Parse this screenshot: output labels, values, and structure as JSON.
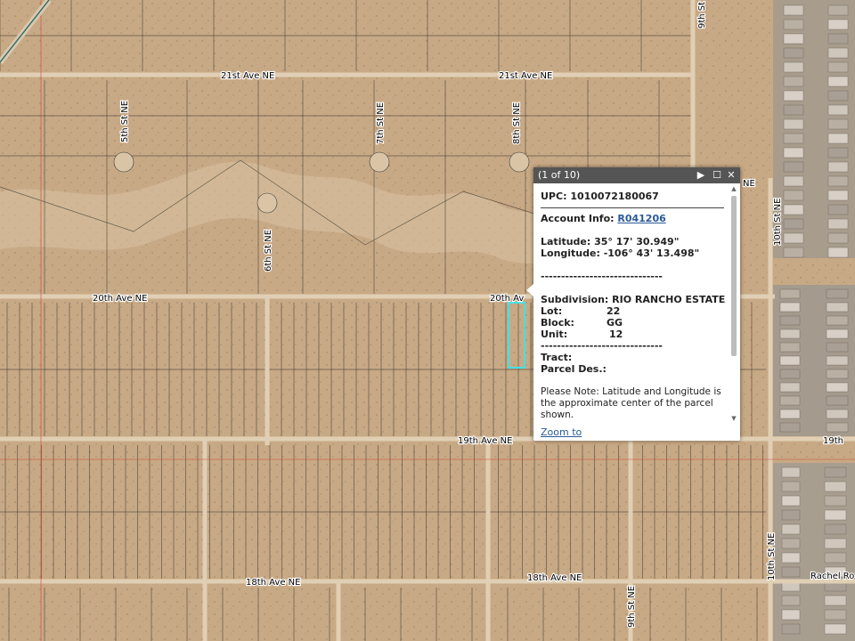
{
  "map": {
    "roads": {
      "ave_21_left": "21st Ave NE",
      "ave_21_right": "21st Ave NE",
      "ave_20_left": "20th Ave NE",
      "ave_20_right_partial": "20th Av",
      "ave_19": "19th Ave NE",
      "ave_19_right_partial": "19th",
      "ave_18_left": "18th Ave NE",
      "ave_18_right": "18th Ave NE",
      "st_5": "5th St NE",
      "st_6": "6th St NE",
      "st_7": "7th St NE",
      "st_8": "8th St NE",
      "st_9_top": "9th St",
      "st_9_bottom": "9th St NE",
      "st_10_upper": "10th St NE",
      "st_10_lower": "10th St NE",
      "rachel": "Rachel Ro",
      "ne_partial": "NE"
    },
    "selection_color": "#44e0e6"
  },
  "popup": {
    "counter": "(1 of 10)",
    "buttons": {
      "next": "▶",
      "maximize": "☐",
      "close": "✕"
    },
    "upc_label": "UPC:",
    "upc_value": "1010072180067",
    "account_label": "Account Info:",
    "account_link": "R041206",
    "latitude": "Latitude: 35° 17' 30.949\"",
    "longitude": "Longitude: -106° 43' 13.498\"",
    "separator1": "------------------------------",
    "subdivision": "Subdivision: RIO RANCHO ESTATES",
    "lot_label": "Lot:",
    "lot_value": "22",
    "block_label": "Block:",
    "block_value": "GG",
    "unit_label": "Unit:",
    "unit_value": "12",
    "separator2": "------------------------------",
    "tract": "Tract:",
    "parcel": "Parcel Des.:",
    "note1": "Please Note: Latitude and Longitude is",
    "note2": "the approximate center of the parcel",
    "note3": "shown.",
    "zoom_link": "Zoom to"
  }
}
